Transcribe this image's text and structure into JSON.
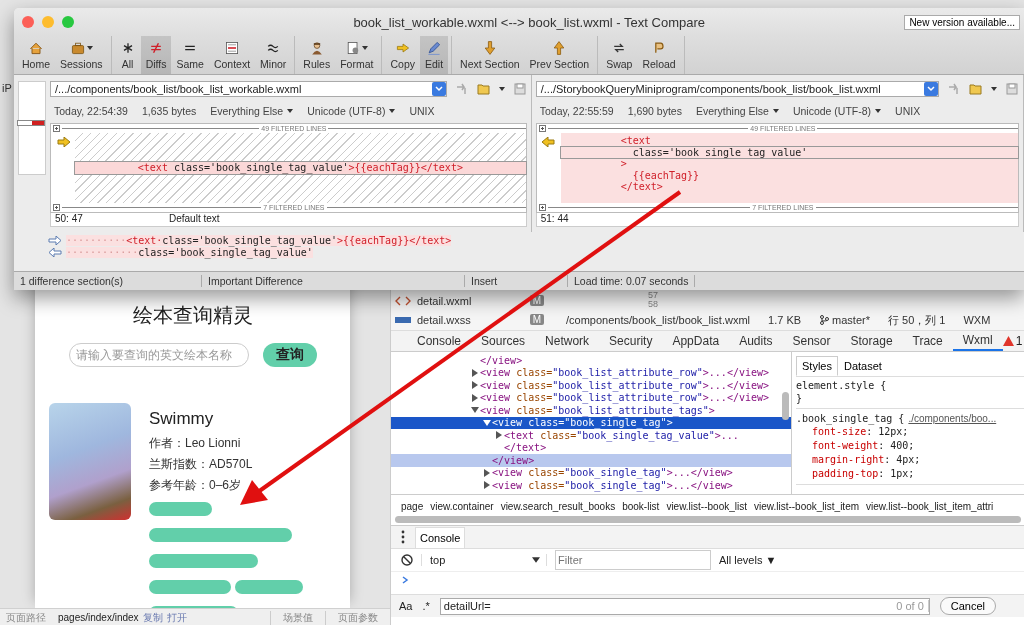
{
  "desktop": {
    "edge_text": "iP"
  },
  "simulator": {
    "title": "绘本查询精灵",
    "search_placeholder": "请输入要查询的英文绘本名称",
    "search_button": "查询",
    "book": {
      "title": "Swimmy",
      "details": [
        "作者：Leo Lionni",
        "兰斯指数：AD570L",
        "参考年龄：0–6岁"
      ]
    },
    "footer": {
      "path_label": "页面路径",
      "path": "pages/index/index",
      "actions": [
        "复制",
        "打开"
      ],
      "tabs": [
        "场景值",
        "页面参数"
      ]
    }
  },
  "devtools": {
    "files": [
      {
        "name": "detail.wxml",
        "kind": "markup",
        "badge": "M"
      },
      {
        "name": "detail.wxss",
        "kind": "style",
        "badge": "M"
      }
    ],
    "line_numbers": [
      "57",
      "58"
    ],
    "status": {
      "path": "/components/book_list/book_list.wxml",
      "size": "1.7 KB",
      "branch": "master*",
      "cursor": "行 50，列 1",
      "language": "WXM"
    },
    "tabs": [
      {
        "label": "Console",
        "selected": false
      },
      {
        "label": "Sources",
        "selected": false
      },
      {
        "label": "Network",
        "selected": false
      },
      {
        "label": "Security",
        "selected": false
      },
      {
        "label": "AppData",
        "selected": false
      },
      {
        "label": "Audits",
        "selected": false
      },
      {
        "label": "Sensor",
        "selected": false
      },
      {
        "label": "Storage",
        "selected": false
      },
      {
        "label": "Trace",
        "selected": false
      },
      {
        "label": "Wxml",
        "selected": true
      }
    ],
    "warning_count": "1",
    "tree": [
      {
        "markup": "</view>",
        "selected": false,
        "hovered": false
      },
      {
        "markup": "<view class=\"book_list_attribute_row\">...</view>",
        "expanded": false,
        "selected": false,
        "hovered": false
      },
      {
        "markup": "<view class=\"book_list_attribute_row\">...</view>",
        "expanded": false,
        "selected": false,
        "hovered": false
      },
      {
        "markup": "<view class=\"book_list_attribute_row\">...</view>",
        "expanded": false,
        "selected": false,
        "hovered": false
      },
      {
        "markup": "<view class=\"book_list_attribute_tags\">",
        "expanded": true,
        "selected": false,
        "hovered": false,
        "children": [
          {
            "markup": "<view class=\"book_single_tag\">",
            "expanded": true,
            "selected": true,
            "hovered": false,
            "children": [
              {
                "markup": "<text class=\"book_single_tag_value\">...",
                "expanded": false,
                "selected": false,
                "hovered": false
              },
              {
                "markup": "</text>",
                "selected": false,
                "hovered": false
              }
            ]
          },
          {
            "markup": "</view>",
            "selected": false,
            "hovered": true
          },
          {
            "markup": "<view class=\"book_single_tag\">...</view>",
            "expanded": false,
            "selected": false,
            "hovered": false
          },
          {
            "markup": "<view class=\"book_single_tag\">...</view>",
            "expanded": false,
            "selected": false,
            "hovered": false
          }
        ]
      }
    ],
    "style_tabs": [
      {
        "label": "Styles",
        "selected": true
      },
      {
        "label": "Dataset",
        "selected": false
      }
    ],
    "style_rules": [
      {
        "selector": "element.style {",
        "close": "}"
      },
      {
        "selector": ".book_single_tag {",
        "source": "./components/boo...",
        "declarations": [
          "font-size: 12px;",
          "font-weight: 400;",
          "margin-right: 4px;",
          "padding-top: 1px;"
        ]
      }
    ],
    "breadcrumb": [
      "page",
      "view.container",
      "view.search_result_books",
      "book-list",
      "view.list--book_list",
      "view.list--book_list_item",
      "view.list--book_list_item_attri"
    ],
    "drawer": {
      "tab": "Console",
      "context": "top",
      "filter_placeholder": "Filter",
      "levels": "All levels ▼",
      "search": {
        "case_toggle": "Aa",
        "regex_toggle": ".*",
        "value": "detailUrl=",
        "count": "0 of 0",
        "cancel": "Cancel"
      }
    }
  },
  "compare_window": {
    "title": "book_list_workable.wxml <--> book_list.wxml - Text Compare",
    "update_button": "New version available...",
    "toolbar": [
      [
        {
          "label": "Home",
          "kind": "home",
          "selected": false
        },
        {
          "label": "Sessions",
          "kind": "briefcase",
          "selected": false,
          "dropdown": true
        }
      ],
      [
        {
          "label": "All",
          "kind": "asterisk",
          "selected": false
        },
        {
          "label": "Diffs",
          "kind": "not-equal",
          "selected": true
        },
        {
          "label": "Same",
          "kind": "equal",
          "selected": false
        },
        {
          "label": "Context",
          "kind": "context",
          "selected": false
        },
        {
          "label": "Minor",
          "kind": "approx",
          "selected": false
        }
      ],
      [
        {
          "label": "Rules",
          "kind": "person",
          "selected": false
        },
        {
          "label": "Format",
          "kind": "format",
          "selected": false,
          "dropdown": true
        }
      ],
      [
        {
          "label": "Copy",
          "kind": "copy-arrow",
          "selected": false
        },
        {
          "label": "Edit",
          "kind": "pencil",
          "selected": true
        }
      ],
      [
        {
          "label": "Next Section",
          "kind": "down-arrow",
          "selected": false
        },
        {
          "label": "Prev Section",
          "kind": "up-arrow",
          "selected": false
        }
      ],
      [
        {
          "label": "Swap",
          "kind": "swap",
          "selected": false
        },
        {
          "label": "Reload",
          "kind": "reload",
          "selected": false
        }
      ]
    ],
    "panes": [
      {
        "path": "/.../components/book_list/book_list_workable.wxml",
        "date": "Today, 22:54:39",
        "size": "1,635 bytes",
        "format": "Everything Else",
        "encoding": "Unicode (UTF-8)",
        "line_endings": "UNIX",
        "filtered_above": "49 FILTERED LINES",
        "filtered_below": "7 FILTERED LINES",
        "lines": [
          {
            "current": true,
            "segments": [
              {
                "text": "<text",
                "kind": "tag"
              },
              {
                "text": " class='book_single_tag_value'",
                "kind": "plain"
              },
              {
                "text": ">{{eachTag}}</text>",
                "kind": "tag"
              }
            ]
          }
        ],
        "position": "50: 47",
        "mode": "Default text"
      },
      {
        "path": "/.../StorybookQueryMiniprogram/components/book_list/book_list.wxml",
        "date": "Today, 22:55:59",
        "size": "1,690 bytes",
        "format": "Everything Else",
        "encoding": "Unicode (UTF-8)",
        "line_endings": "UNIX",
        "filtered_above": "49 FILTERED LINES",
        "filtered_below": "7 FILTERED LINES",
        "lines": [
          {
            "current": false,
            "segments": [
              {
                "text": "<text",
                "kind": "tag"
              }
            ]
          },
          {
            "current": true,
            "segments": [
              {
                "text": "  class='book_single_tag_value'",
                "kind": "plain"
              }
            ]
          },
          {
            "current": false,
            "segments": [
              {
                "text": ">",
                "kind": "tag"
              }
            ]
          },
          {
            "current": false,
            "segments": [
              {
                "text": "  {{eachTag}}",
                "kind": "tag"
              }
            ]
          },
          {
            "current": false,
            "segments": [
              {
                "text": "</text>",
                "kind": "tag"
              }
            ]
          }
        ],
        "position": "51: 44"
      }
    ],
    "compare_lines": [
      {
        "kind": "right",
        "segments": [
          {
            "text": "··········",
            "kind": "space"
          },
          {
            "text": "<text·",
            "kind": "tag"
          },
          {
            "text": "class='book_single_tag_value'",
            "kind": "plain"
          },
          {
            "text": ">{{eachTag}}</text>",
            "kind": "tag"
          }
        ]
      },
      {
        "kind": "left",
        "segments": [
          {
            "text": "··········",
            "kind": "space"
          },
          {
            "text": "··",
            "kind": "space"
          },
          {
            "text": "class='book_single_tag_value'",
            "kind": "plain"
          }
        ]
      }
    ],
    "status": [
      "1 difference section(s)",
      "Important Difference",
      "Insert",
      "Load time: 0.07 seconds"
    ]
  }
}
